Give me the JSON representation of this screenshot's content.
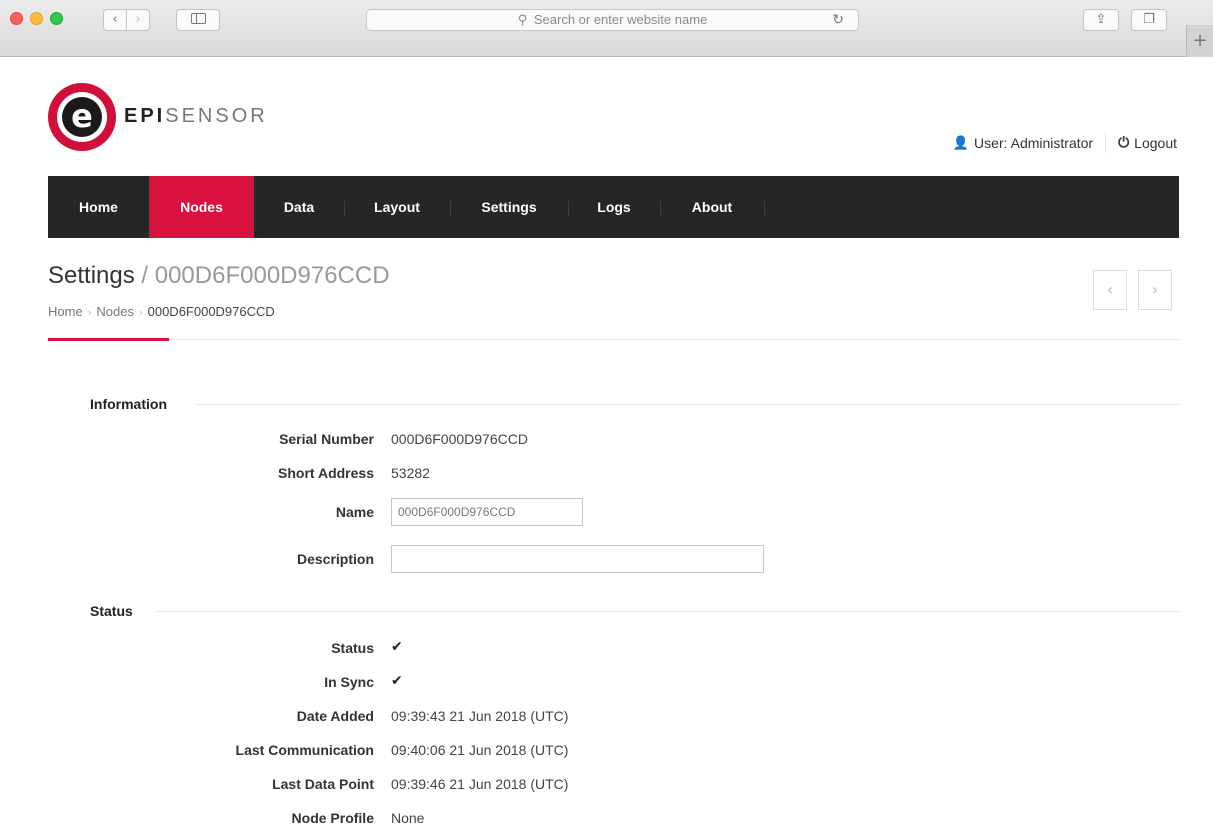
{
  "browser": {
    "address_placeholder": "Search or enter website name",
    "search_glyph": "⚲",
    "reload_glyph": "↻",
    "back_glyph": "‹",
    "forward_glyph": "›",
    "share_glyph": "⇪",
    "tabs_glyph": "❐",
    "new_tab_glyph": "+"
  },
  "logo": {
    "mark_letter": "e",
    "part1": "EPI",
    "part2": "SENSOR"
  },
  "user": {
    "icon": "👤",
    "label": "User: Administrator",
    "logout_icon": "⏻",
    "logout_label": "Logout"
  },
  "nav": {
    "items": [
      {
        "label": "Home",
        "active": false
      },
      {
        "label": "Nodes",
        "active": true
      },
      {
        "label": "Data",
        "active": false
      },
      {
        "label": "Layout",
        "active": false
      },
      {
        "label": "Settings",
        "active": false
      },
      {
        "label": "Logs",
        "active": false
      },
      {
        "label": "About",
        "active": false
      }
    ]
  },
  "header": {
    "title": "Settings",
    "title_sep": " / ",
    "subtitle": "000D6F000D976CCD",
    "prev_glyph": "‹",
    "next_glyph": "›"
  },
  "breadcrumb": {
    "items": [
      "Home",
      "Nodes",
      "000D6F000D976CCD"
    ],
    "sep": "›"
  },
  "information": {
    "heading": "Information",
    "serial_label": "Serial Number",
    "serial_value": "000D6F000D976CCD",
    "short_address_label": "Short Address",
    "short_address_value": "53282",
    "name_label": "Name",
    "name_placeholder": "000D6F000D976CCD",
    "description_label": "Description",
    "description_value": ""
  },
  "status": {
    "heading": "Status",
    "status_label": "Status",
    "status_value": "✔",
    "in_sync_label": "In Sync",
    "in_sync_value": "✔",
    "date_added_label": "Date Added",
    "date_added_value": "09:39:43 21 Jun 2018 (UTC)",
    "last_comm_label": "Last Communication",
    "last_comm_value": "09:40:06 21 Jun 2018 (UTC)",
    "last_data_label": "Last Data Point",
    "last_data_value": "09:39:46 21 Jun 2018 (UTC)",
    "node_profile_label": "Node Profile",
    "node_profile_value": "None"
  },
  "colors": {
    "accent": "#d8113e",
    "navbar": "#262626"
  }
}
